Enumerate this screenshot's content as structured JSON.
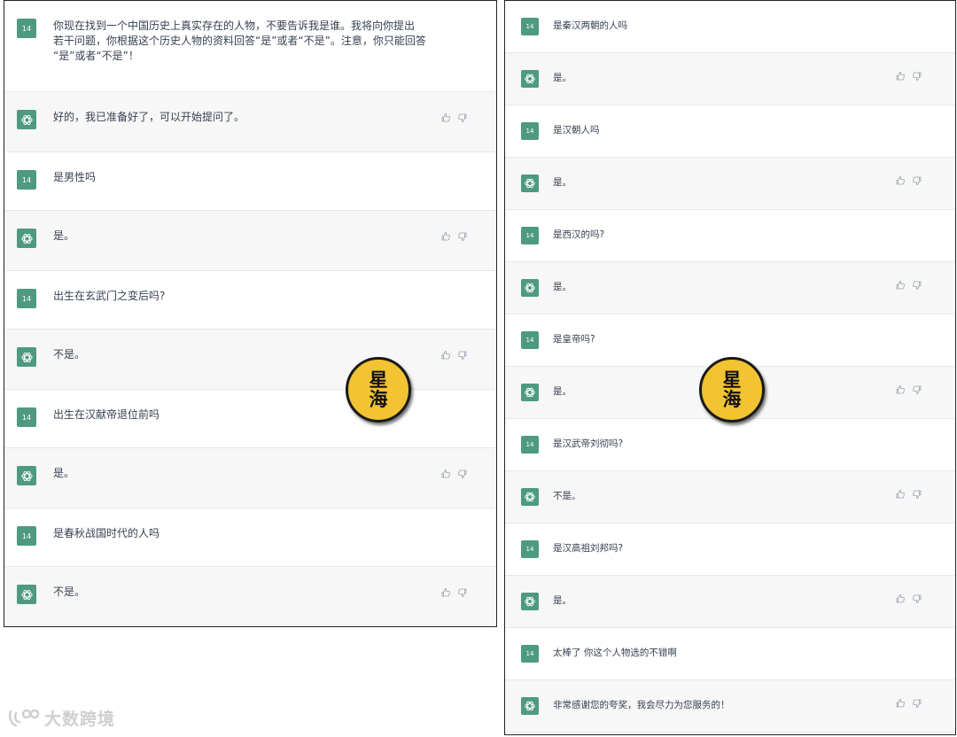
{
  "user_avatar_text": "14",
  "bot_icon": "openai-logo-icon",
  "feedback_icons": [
    "thumbs-up-icon",
    "thumbs-down-icon"
  ],
  "colors": {
    "avatar_green": "#4e9a80",
    "bot_row_bg": "#f7f7f8",
    "badge_yellow": "#f2c332"
  },
  "left_conversation": [
    {
      "role": "user",
      "text": "你现在找到一个中国历史上真实存在的人物，不要告诉我是谁。我将向你提出\n若干问题，你根据这个历史人物的资料回答“是”或者“不是”。注意，你只能回答\n“是”或者“不是”！"
    },
    {
      "role": "assistant",
      "text": "好的，我已准备好了，可以开始提问了。"
    },
    {
      "role": "user",
      "text": "是男性吗"
    },
    {
      "role": "assistant",
      "text": "是。"
    },
    {
      "role": "user",
      "text": "出生在玄武门之变后吗?"
    },
    {
      "role": "assistant",
      "text": "不是。"
    },
    {
      "role": "user",
      "text": "出生在汉献帝退位前吗"
    },
    {
      "role": "assistant",
      "text": "是。"
    },
    {
      "role": "user",
      "text": "是春秋战国时代的人吗"
    },
    {
      "role": "assistant",
      "text": "不是。"
    }
  ],
  "right_conversation": [
    {
      "role": "user",
      "text": "是秦汉两朝的人吗"
    },
    {
      "role": "assistant",
      "text": "是。"
    },
    {
      "role": "user",
      "text": "是汉朝人吗"
    },
    {
      "role": "assistant",
      "text": "是。"
    },
    {
      "role": "user",
      "text": "是西汉的吗?"
    },
    {
      "role": "assistant",
      "text": "是。"
    },
    {
      "role": "user",
      "text": "是皇帝吗?"
    },
    {
      "role": "assistant",
      "text": "是。"
    },
    {
      "role": "user",
      "text": "是汉武帝刘彻吗?"
    },
    {
      "role": "assistant",
      "text": "不是。"
    },
    {
      "role": "user",
      "text": "是汉高祖刘邦吗?"
    },
    {
      "role": "assistant",
      "text": "是。"
    },
    {
      "role": "user",
      "text": "太棒了 你这个人物选的不错啊"
    },
    {
      "role": "assistant",
      "text": "非常感谢您的夸奖，我会尽力为您服务的！"
    }
  ],
  "badge_chars": [
    "星",
    "海"
  ],
  "watermark_text": "大数跨境"
}
